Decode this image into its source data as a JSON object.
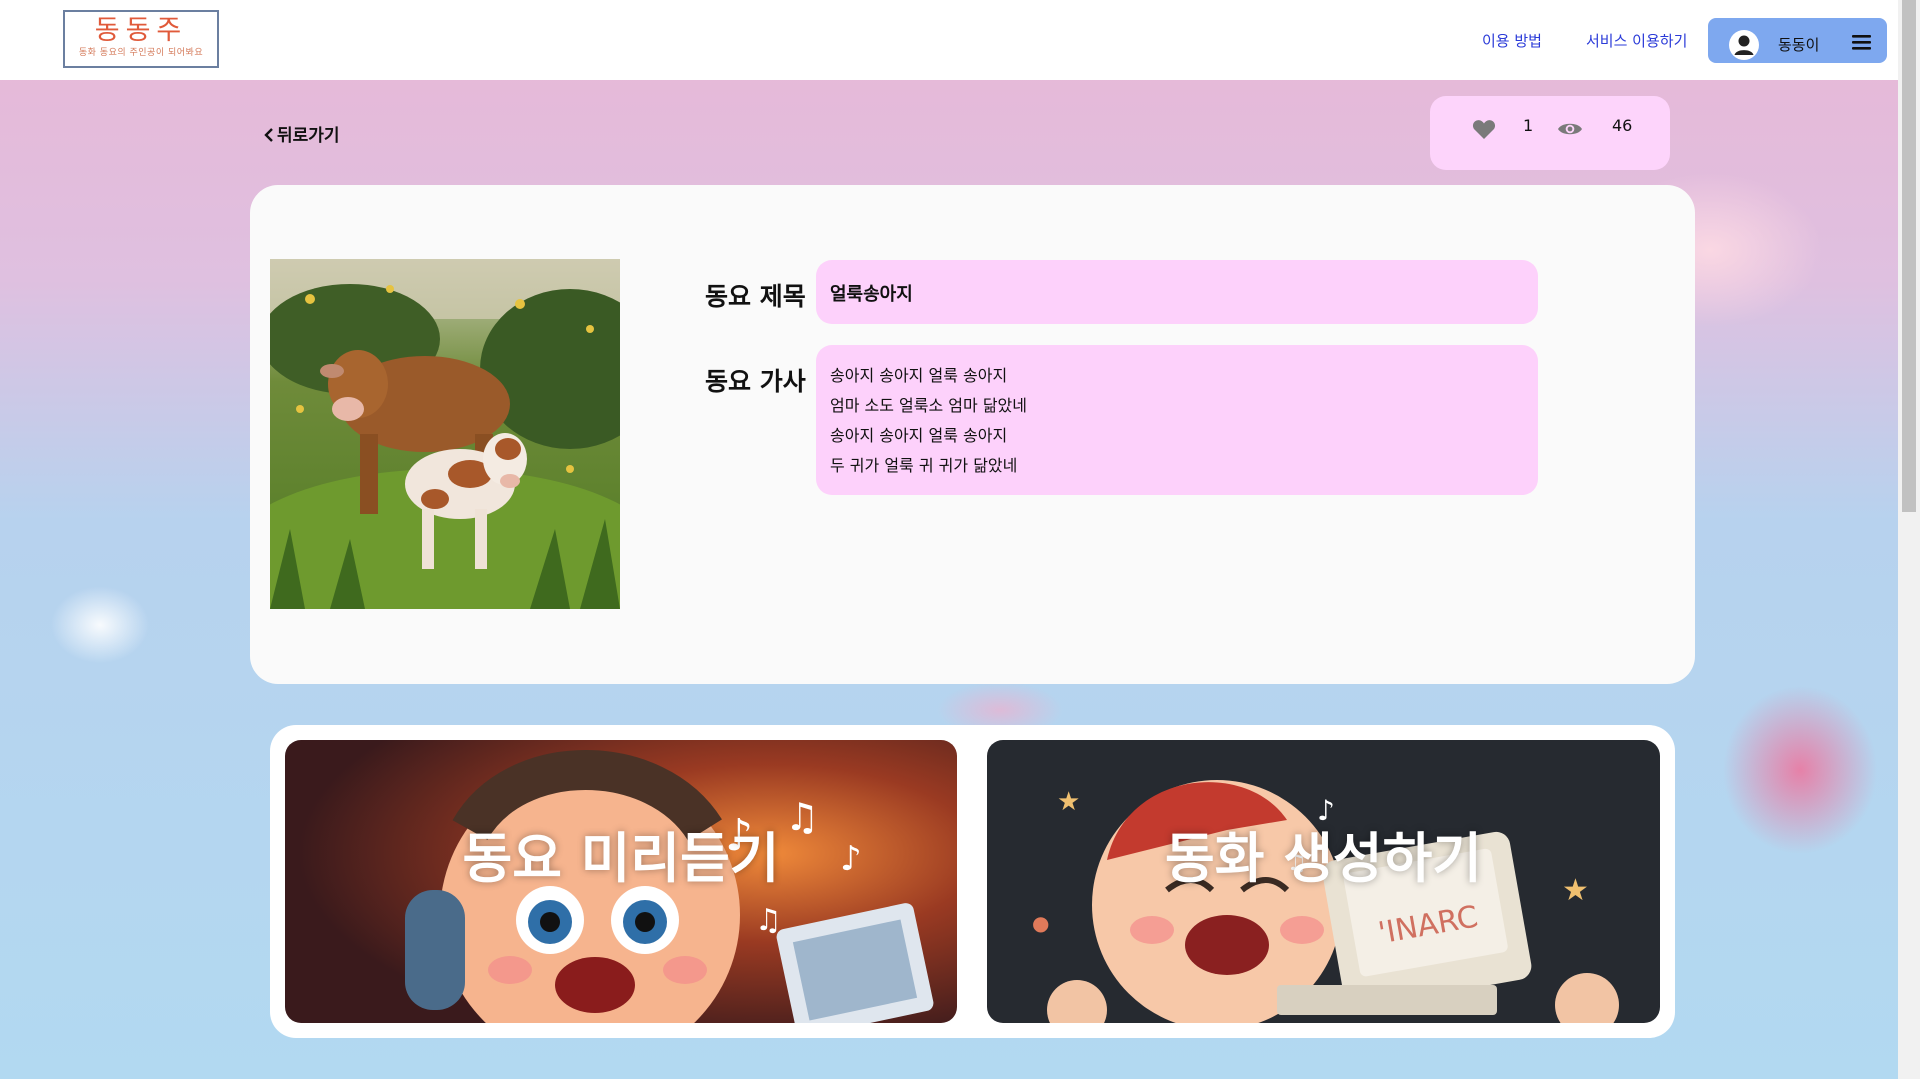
{
  "header": {
    "logo_title": "동동주",
    "logo_subtitle": "동화 동요의 주인공이 되어봐요",
    "nav_howto": "이용 방법",
    "nav_service": "서비스 이용하기",
    "user_name": "동동이"
  },
  "toolbar": {
    "back_label": "뒤로가기",
    "like_count": "1",
    "view_count": "46"
  },
  "song": {
    "title_label": "동요 제목",
    "title": "얼룩송아지",
    "lyrics_label": "동요 가사",
    "lyrics": [
      "송아지 송아지 얼룩 송아지",
      "엄마 소도 얼룩소 엄마 닮았네",
      "송아지 송아지 얼룩 송아지",
      "두 귀가 얼룩 귀 귀가 닮았네"
    ]
  },
  "actions": {
    "listen_label": "동요 미리듣기",
    "create_label": "동화 생성하기",
    "computer_screen_text": "'INARC"
  },
  "icons": {
    "user": "user-avatar-icon",
    "menu": "hamburger-menu-icon",
    "back": "chevron-left-icon",
    "like": "heart-icon",
    "views": "eye-icon"
  },
  "colors": {
    "header_bg": "#ffffff",
    "nav_link": "#2b3bd8",
    "user_button": "#7ea8ef",
    "accent_pink": "#fdd1fb",
    "logo_red": "#e05a3a"
  }
}
